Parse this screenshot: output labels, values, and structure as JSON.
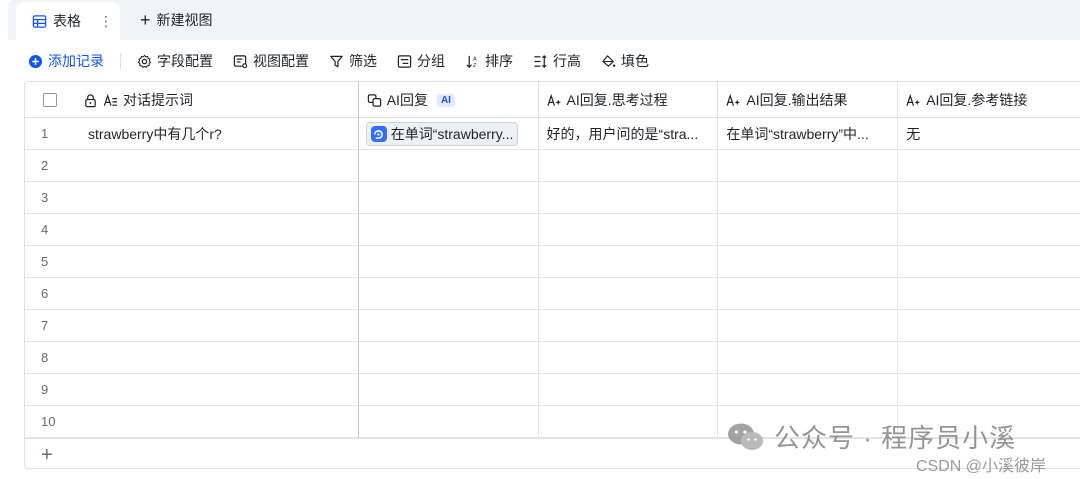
{
  "tabs": {
    "active_label": "表格",
    "more_label": "⋮",
    "new_view_label": "新建视图"
  },
  "toolbar": {
    "add_record": "添加记录",
    "field_config": "字段配置",
    "view_config": "视图配置",
    "filter": "筛选",
    "group": "分组",
    "sort": "排序",
    "row_height": "行高",
    "fill_color": "填色"
  },
  "columns": [
    {
      "label": "对话提示词"
    },
    {
      "label": "AI回复",
      "tag": "AI"
    },
    {
      "label": "AI回复.思考过程"
    },
    {
      "label": "AI回复.输出结果"
    },
    {
      "label": "AI回复.参考链接"
    }
  ],
  "rows": [
    {
      "num": "1",
      "prompt": "strawberry中有几个r?",
      "reply": "在单词“strawberry...",
      "thinking": "好的，用户问的是“stra...",
      "output": "在单词“strawberry”中...",
      "links": "无"
    },
    {
      "num": "2"
    },
    {
      "num": "3"
    },
    {
      "num": "4"
    },
    {
      "num": "5"
    },
    {
      "num": "6"
    },
    {
      "num": "7"
    },
    {
      "num": "8"
    },
    {
      "num": "9"
    },
    {
      "num": "10"
    }
  ],
  "add_row_label": "+",
  "watermark": {
    "text": "公众号 · 程序员小溪",
    "credit": "CSDN @小溪彼岸"
  },
  "colors": {
    "accent": "#1456f0",
    "border": "#dee0e3",
    "tab_bg": "#f2f3f5"
  }
}
